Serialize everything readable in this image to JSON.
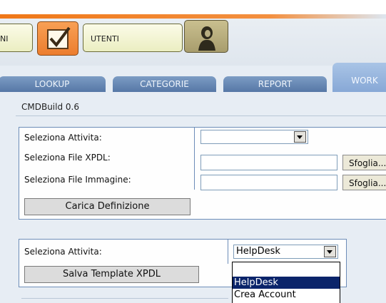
{
  "modules": {
    "prev_label": "NI",
    "check_icon": "checkmark-icon",
    "utenti_label": "UTENTI",
    "user_icon": "user-bust-icon"
  },
  "tabs": [
    {
      "label": "LOOKUP"
    },
    {
      "label": "CATEGORIE"
    },
    {
      "label": "REPORT"
    },
    {
      "label": "WORK"
    }
  ],
  "app": {
    "version": "CMDBuild 0.6"
  },
  "definition_form": {
    "activity_label": "Seleziona Attivita:",
    "activity_value": "",
    "xpdl_label": "Seleziona File XPDL:",
    "xpdl_value": "",
    "image_label": "Seleziona File Immagine:",
    "image_value": "",
    "browse_label": "Sfoglia...",
    "load_button": "Carica Definizione"
  },
  "template_form": {
    "activity_label": "Seleziona Attivita:",
    "activity_value": "HelpDesk",
    "save_button": "Salva Template XPDL",
    "options": [
      "",
      "HelpDesk",
      "Crea Account"
    ],
    "highlighted_option": "HelpDesk"
  },
  "colors": {
    "accent_orange": "#f07818",
    "tab_blue": "#5677a6",
    "active_tab": "#87a8d6",
    "selection": "#0a246a"
  }
}
